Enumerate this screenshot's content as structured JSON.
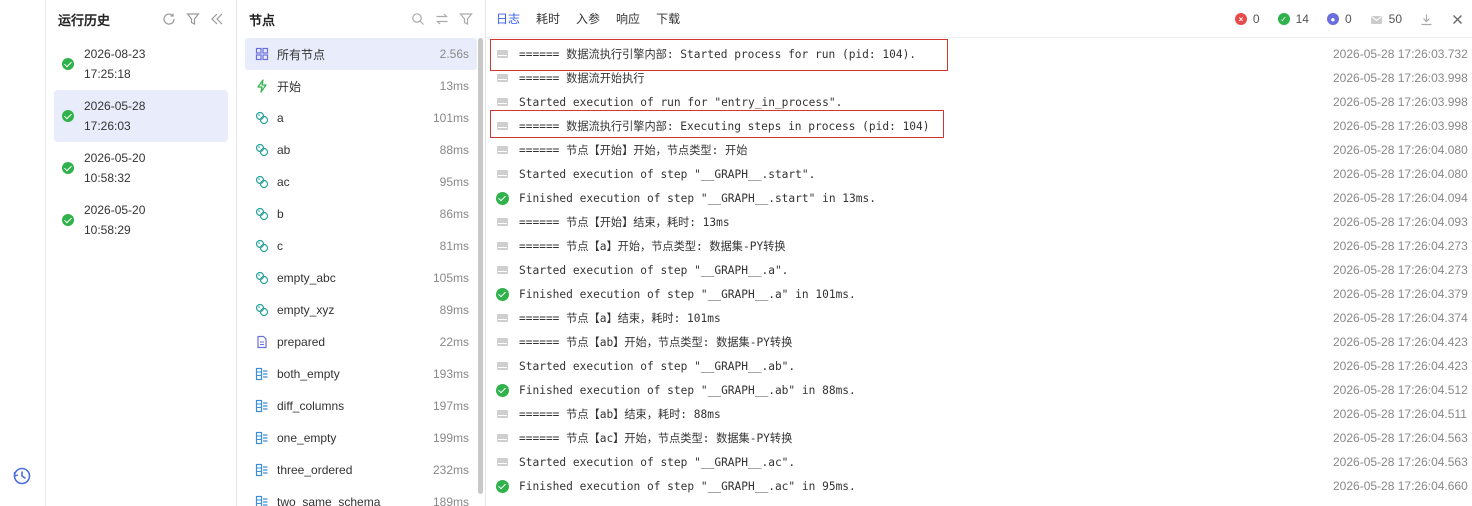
{
  "history": {
    "title": "运行历史",
    "items": [
      {
        "date": "2026-08-23",
        "time": "17:25:18",
        "active": false
      },
      {
        "date": "2026-05-28",
        "time": "17:26:03",
        "active": true
      },
      {
        "date": "2026-05-20",
        "time": "10:58:32",
        "active": false
      },
      {
        "date": "2026-05-20",
        "time": "10:58:29",
        "active": false
      }
    ]
  },
  "nodes": {
    "title": "节点",
    "items": [
      {
        "name": "所有节点",
        "time": "2.56s",
        "icon": "grid-icon"
      },
      {
        "name": "开始",
        "time": "13ms",
        "icon": "lightning-icon"
      },
      {
        "name": "a",
        "time": "101ms",
        "icon": "python-transform-icon"
      },
      {
        "name": "ab",
        "time": "88ms",
        "icon": "python-transform-icon"
      },
      {
        "name": "ac",
        "time": "95ms",
        "icon": "python-transform-icon"
      },
      {
        "name": "b",
        "time": "86ms",
        "icon": "python-transform-icon"
      },
      {
        "name": "c",
        "time": "81ms",
        "icon": "python-transform-icon"
      },
      {
        "name": "empty_abc",
        "time": "105ms",
        "icon": "python-transform-icon"
      },
      {
        "name": "empty_xyz",
        "time": "89ms",
        "icon": "python-transform-icon"
      },
      {
        "name": "prepared",
        "time": "22ms",
        "icon": "document-icon"
      },
      {
        "name": "both_empty",
        "time": "193ms",
        "icon": "table-join-icon"
      },
      {
        "name": "diff_columns",
        "time": "197ms",
        "icon": "table-join-icon"
      },
      {
        "name": "one_empty",
        "time": "199ms",
        "icon": "table-join-icon"
      },
      {
        "name": "three_ordered",
        "time": "232ms",
        "icon": "table-join-icon"
      },
      {
        "name": "two_same_schema",
        "time": "189ms",
        "icon": "table-join-icon"
      }
    ]
  },
  "tabs": [
    "日志",
    "耗时",
    "入参",
    "响应",
    "下载"
  ],
  "counters": {
    "errors": "0",
    "success": "14",
    "users": "0",
    "messages": "50"
  },
  "colors": {
    "accent": "#3a63e6",
    "success": "#2fb14b",
    "error": "#e84a4a",
    "highlight": "#d0372f"
  },
  "logs": [
    {
      "type": "info",
      "msg": "====== 数据流执行引擎内部: Started process for run (pid: 104).",
      "time": "2026-05-28 17:26:03.732"
    },
    {
      "type": "info",
      "msg": "====== 数据流开始执行",
      "time": "2026-05-28 17:26:03.998"
    },
    {
      "type": "info",
      "msg": "Started execution of run for \"entry_in_process\".",
      "time": "2026-05-28 17:26:03.998"
    },
    {
      "type": "info",
      "msg": "====== 数据流执行引擎内部: Executing steps in process (pid: 104)",
      "time": "2026-05-28 17:26:03.998"
    },
    {
      "type": "info",
      "msg": "====== 节点【开始】开始，节点类型: 开始",
      "time": "2026-05-28 17:26:04.080"
    },
    {
      "type": "info",
      "msg": "Started execution of step \"__GRAPH__.start\".",
      "time": "2026-05-28 17:26:04.080"
    },
    {
      "type": "success",
      "msg": "Finished execution of step \"__GRAPH__.start\" in 13ms.",
      "time": "2026-05-28 17:26:04.094"
    },
    {
      "type": "info",
      "msg": "====== 节点【开始】结束，耗时: 13ms",
      "time": "2026-05-28 17:26:04.093"
    },
    {
      "type": "info",
      "msg": "====== 节点【a】开始，节点类型: 数据集-PY转换",
      "time": "2026-05-28 17:26:04.273"
    },
    {
      "type": "info",
      "msg": "Started execution of step \"__GRAPH__.a\".",
      "time": "2026-05-28 17:26:04.273"
    },
    {
      "type": "success",
      "msg": "Finished execution of step \"__GRAPH__.a\" in 101ms.",
      "time": "2026-05-28 17:26:04.379"
    },
    {
      "type": "info",
      "msg": "====== 节点【a】结束，耗时: 101ms",
      "time": "2026-05-28 17:26:04.374"
    },
    {
      "type": "info",
      "msg": "====== 节点【ab】开始，节点类型: 数据集-PY转换",
      "time": "2026-05-28 17:26:04.423"
    },
    {
      "type": "info",
      "msg": "Started execution of step \"__GRAPH__.ab\".",
      "time": "2026-05-28 17:26:04.423"
    },
    {
      "type": "success",
      "msg": "Finished execution of step \"__GRAPH__.ab\" in 88ms.",
      "time": "2026-05-28 17:26:04.512"
    },
    {
      "type": "info",
      "msg": "====== 节点【ab】结束，耗时: 88ms",
      "time": "2026-05-28 17:26:04.511"
    },
    {
      "type": "info",
      "msg": "====== 节点【ac】开始，节点类型: 数据集-PY转换",
      "time": "2026-05-28 17:26:04.563"
    },
    {
      "type": "info",
      "msg": "Started execution of step \"__GRAPH__.ac\".",
      "time": "2026-05-28 17:26:04.563"
    },
    {
      "type": "success",
      "msg": "Finished execution of step \"__GRAPH__.ac\" in 95ms.",
      "time": "2026-05-28 17:26:04.660"
    }
  ]
}
